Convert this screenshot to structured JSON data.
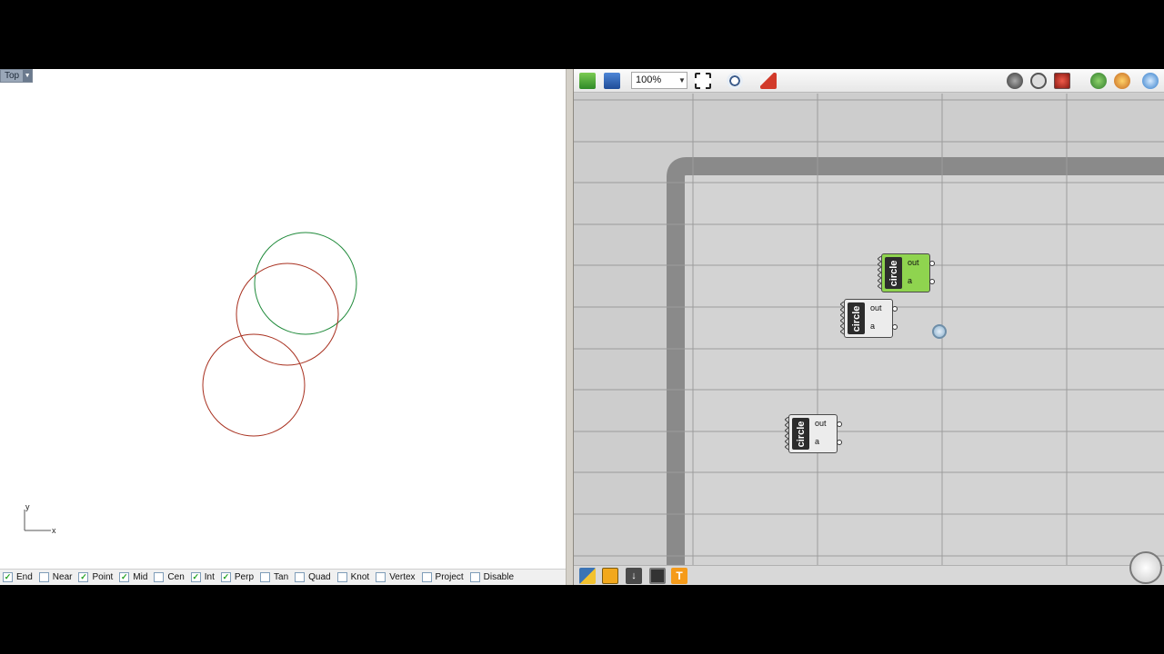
{
  "rhino": {
    "viewport_label": "Top",
    "axis": {
      "y": "y",
      "x": "x"
    },
    "osnaps": [
      {
        "label": "End",
        "checked": true
      },
      {
        "label": "Near",
        "checked": false
      },
      {
        "label": "Point",
        "checked": true
      },
      {
        "label": "Mid",
        "checked": true
      },
      {
        "label": "Cen",
        "checked": false
      },
      {
        "label": "Int",
        "checked": true
      },
      {
        "label": "Perp",
        "checked": true
      },
      {
        "label": "Tan",
        "checked": false
      },
      {
        "label": "Quad",
        "checked": false
      },
      {
        "label": "Knot",
        "checked": false
      },
      {
        "label": "Vertex",
        "checked": false
      },
      {
        "label": "Project",
        "checked": false
      },
      {
        "label": "Disable",
        "checked": false
      }
    ]
  },
  "grasshopper": {
    "zoom": "100%",
    "components": [
      {
        "name": "circle",
        "out": "out",
        "input": "a",
        "state": "selected"
      },
      {
        "name": "circle",
        "out": "out",
        "input": "a",
        "state": "normal"
      },
      {
        "name": "circle",
        "out": "out",
        "input": "a",
        "state": "normal"
      }
    ]
  },
  "colors": {
    "circle_selected": "#1f8a3a",
    "circle_normal": "#a8301f",
    "component_selected": "#8fd44f",
    "component_normal": "#ececec",
    "canvas": "#cdcdcd"
  },
  "icons": {
    "toolbar": [
      "open-file-icon",
      "save-file-icon",
      "zoom-extents-icon",
      "preview-eye-icon",
      "sketch-pen-icon",
      "bake-icon",
      "display-icon",
      "cluster-icon",
      "cull-icon",
      "material-icon",
      "sphere-icon"
    ],
    "bottom": [
      "python-icon",
      "script-icon",
      "download-icon",
      "disk-icon",
      "tools-icon"
    ]
  }
}
